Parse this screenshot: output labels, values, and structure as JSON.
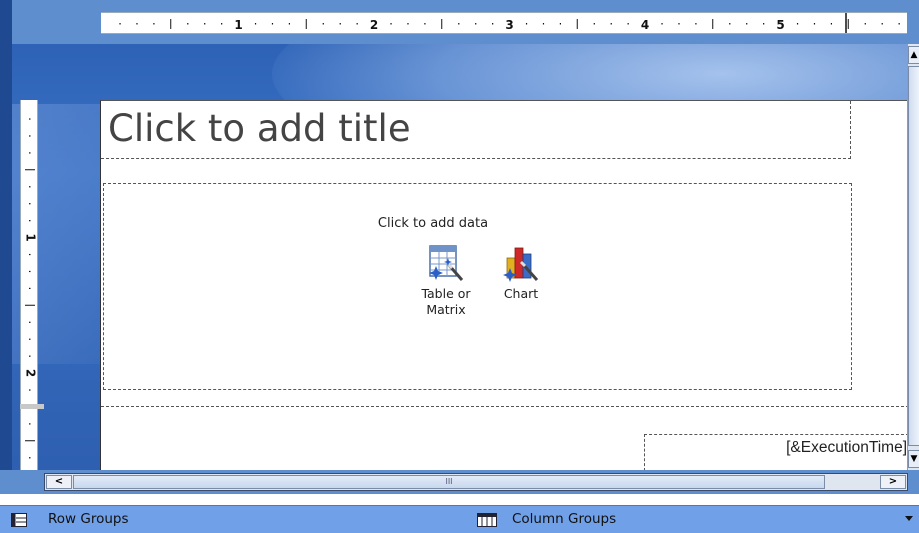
{
  "ruler": {
    "horizontal_numbers": [
      "1",
      "2",
      "3",
      "4",
      "5"
    ],
    "vertical_numbers": [
      "1",
      "2"
    ]
  },
  "report": {
    "title_placeholder": "Click to add title",
    "add_data_label": "Click to add data",
    "wizards": [
      {
        "label": "Table or\nMatrix",
        "icon": "table-wizard-icon"
      },
      {
        "label": "Chart",
        "icon": "chart-wizard-icon"
      }
    ],
    "footer_expression": "[&ExecutionTime]"
  },
  "scrollbars": {
    "thumb_grip": "III"
  },
  "grouping_pane": {
    "row_groups": "Row Groups",
    "column_groups": "Column Groups"
  }
}
